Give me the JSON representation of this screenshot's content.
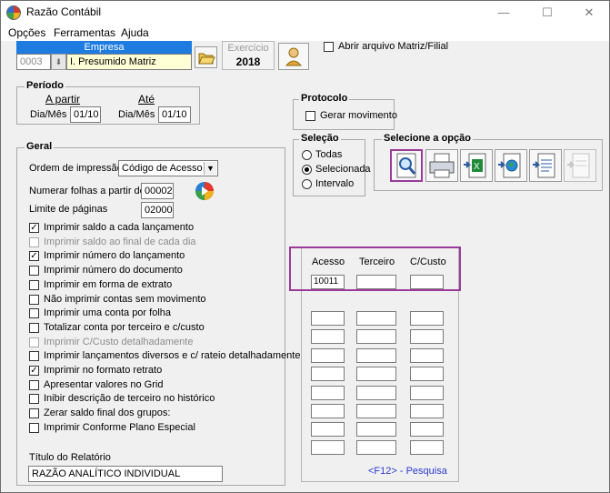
{
  "window": {
    "title": "Razão Contábil",
    "minimize": "—",
    "maximize": "☐",
    "close": "✕"
  },
  "menu": [
    {
      "label": "Opções"
    },
    {
      "label": "Ferramentas"
    },
    {
      "label": "Ajuda"
    }
  ],
  "empresa": {
    "header": "Empresa",
    "code": "0003",
    "name": "I. Presumido Matriz"
  },
  "exercicio": {
    "label": "Exercício",
    "value": "2018"
  },
  "abrir_matriz": {
    "label": "Abrir arquivo Matriz/Filial",
    "checked": false
  },
  "periodo": {
    "title": "Período",
    "a_partir": "A partir",
    "ate": "Até",
    "dia_mes_label": "Dia/Mês",
    "from": "01/10",
    "to": "01/10"
  },
  "protocolo": {
    "title": "Protocolo",
    "gerar_label": "Gerar movimento",
    "checked": false
  },
  "selecao": {
    "title": "Seleção",
    "options": [
      "Todas",
      "Selecionada",
      "Intervalo"
    ],
    "selected": "Selecionada"
  },
  "selecione": {
    "title": "Selecione a opção",
    "icons": [
      "preview-icon",
      "printer-icon",
      "excel-export-icon",
      "web-export-icon",
      "document-export-icon",
      "disabled-export-icon"
    ]
  },
  "geral": {
    "title": "Geral",
    "ordem_label": "Ordem de impressão",
    "ordem_value": "Código de Acesso",
    "numerar_label": "Numerar folhas a partir de",
    "numerar_value": "00002",
    "limite_label": "Limite de páginas",
    "limite_value": "02000",
    "options": [
      {
        "label": "Imprimir saldo a cada lançamento",
        "checked": true,
        "enabled": true
      },
      {
        "label": "Imprimir saldo ao final de cada dia",
        "checked": false,
        "enabled": false
      },
      {
        "label": "Imprimir número do lançamento",
        "checked": true,
        "enabled": true
      },
      {
        "label": "Imprimir número do documento",
        "checked": false,
        "enabled": true
      },
      {
        "label": "Imprimir em forma de extrato",
        "checked": false,
        "enabled": true
      },
      {
        "label": "Não imprimir contas sem movimento",
        "checked": false,
        "enabled": true
      },
      {
        "label": "Imprimir uma conta por folha",
        "checked": false,
        "enabled": true
      },
      {
        "label": "Totalizar conta por terceiro e c/custo",
        "checked": false,
        "enabled": true
      },
      {
        "label": "Imprimir C/Custo detalhadamente",
        "checked": false,
        "enabled": false
      },
      {
        "label": "Imprimir lançamentos diversos e c/ rateio detalhadamente",
        "checked": false,
        "enabled": true
      },
      {
        "label": "Imprimir no formato retrato",
        "checked": true,
        "enabled": true
      },
      {
        "label": "Apresentar valores no Grid",
        "checked": false,
        "enabled": true
      },
      {
        "label": "Inibir descrição de terceiro no histórico",
        "checked": false,
        "enabled": true
      },
      {
        "label": "Zerar saldo final dos grupos:",
        "checked": false,
        "enabled": true
      },
      {
        "label": "Imprimir Conforme Plano Especial",
        "checked": false,
        "enabled": true
      }
    ],
    "titulo_label": "Título do Relatório",
    "titulo_value": "RAZÃO ANALÍTICO INDIVIDUAL"
  },
  "grid": {
    "headers": [
      "Acesso",
      "Terceiro",
      "C/Custo"
    ],
    "first_row": [
      "10011",
      "",
      ""
    ],
    "footer": "<F12> - Pesquisa"
  },
  "colors": {
    "highlight": "#9b3a9b",
    "empresa_header": "#1e7be0",
    "empresa_value_bg": "#ffffd6"
  }
}
